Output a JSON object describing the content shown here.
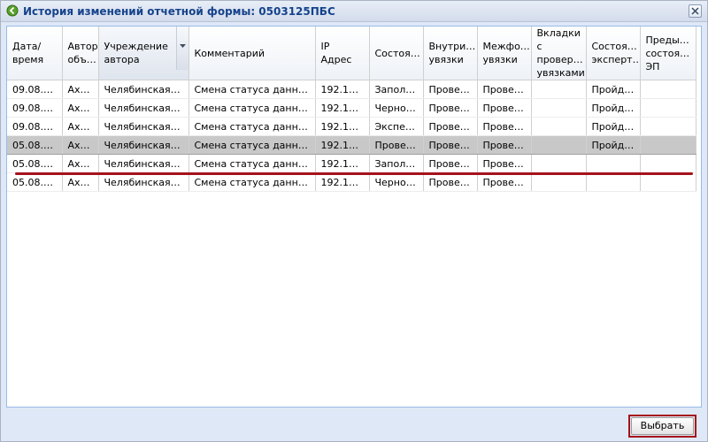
{
  "window": {
    "title": "История изменений отчетной формы: 0503125ПБС",
    "icon": "history-icon"
  },
  "grid": {
    "columns": [
      {
        "label": "Дата/ время"
      },
      {
        "label": "Автор объ…"
      },
      {
        "label": "Учреждение автора"
      },
      {
        "label": "Комментарий"
      },
      {
        "label": "IP Адрес"
      },
      {
        "label": "Состоя…"
      },
      {
        "label": "Внутри… увязки"
      },
      {
        "label": "Межфо… увязки"
      },
      {
        "label": "Вкладки с провер… увязками"
      },
      {
        "label": "Состоя… эксперт…"
      },
      {
        "label": "Преды… состоя… ЭП"
      }
    ],
    "rows": [
      {
        "cells": [
          "09.08.2…",
          "Ах…",
          "Челябинская о…",
          "Смена статуса данных …",
          "192.168…",
          "Заполн…",
          "Провер…",
          "Провер…",
          "",
          "Пройде…",
          ""
        ]
      },
      {
        "cells": [
          "09.08.2…",
          "Ах…",
          "Челябинская о…",
          "Смена статуса данных …",
          "192.168…",
          "Черновик",
          "Провер…",
          "Провер…",
          "",
          "Пройде…",
          ""
        ]
      },
      {
        "cells": [
          "09.08.2…",
          "Ах…",
          "Челябинская о…",
          "Смена статуса данных …",
          "192.168…",
          "Экспер…",
          "Провер…",
          "Провер…",
          "",
          "Пройде…",
          ""
        ]
      },
      {
        "cells": [
          "05.08.2…",
          "Ах…",
          "Челябинская о…",
          "Смена статуса данных …",
          "192.168…",
          "Провер…",
          "Провер…",
          "Провер…",
          "",
          "Пройде…",
          ""
        ],
        "selected": true
      },
      {
        "cells": [
          "05.08.2…",
          "Ах…",
          "Челябинская о…",
          "Смена статуса данных …",
          "192.168…",
          "Заполн…",
          "Провер…",
          "Провер…",
          "",
          "",
          ""
        ]
      },
      {
        "cells": [
          "05.08.2…",
          "Ах…",
          "Челябинская о…",
          "Смена статуса данных …",
          "192.168…",
          "Черновик",
          "Провер…",
          "Провер…",
          "",
          "",
          ""
        ]
      }
    ]
  },
  "footer": {
    "select_label": "Выбрать"
  },
  "colors": {
    "highlight": "#a5121a",
    "selected_row": "#c8c8c8",
    "title_text": "#15428b"
  }
}
